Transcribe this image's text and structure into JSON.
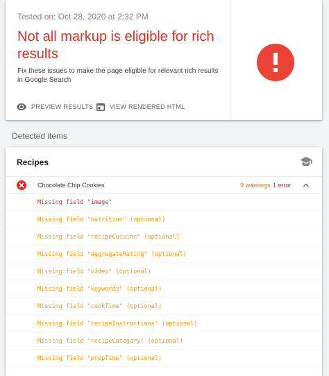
{
  "summary": {
    "tested_on": "Tested on: Oct 28, 2020 at 2:32 PM",
    "headline": "Not all markup is eligible for rich results",
    "subtext": "Fix these issues to make the page eligible for relevant rich results in Google Search",
    "preview_label": "PREVIEW RESULTS",
    "rendered_label": "VIEW RENDERED HTML",
    "status_color": "#ea4335"
  },
  "detected": {
    "label": "Detected items",
    "card_title": "Recipes",
    "item": {
      "name": "Chocolate Chip Cookies",
      "warnings": "9 warnings",
      "errors": "1 error"
    },
    "issues": [
      {
        "text": "Missing field \"image\"",
        "severity": "error"
      },
      {
        "text": "Missing field \"nutrition\" (optional)",
        "severity": "warning"
      },
      {
        "text": "Missing field \"recipeCuisine\" (optional)",
        "severity": "warning"
      },
      {
        "text": "Missing field \"aggregateRating\" (optional)",
        "severity": "warning"
      },
      {
        "text": "Missing field \"video\" (optional)",
        "severity": "warning"
      },
      {
        "text": "Missing field \"keywords\" (optional)",
        "severity": "warning"
      },
      {
        "text": "Missing field \"cookTime\" (optional)",
        "severity": "warning"
      },
      {
        "text": "Missing field \"recipeInstructions\" (optional)",
        "severity": "warning"
      },
      {
        "text": "Missing field \"recipeCategory\" (optional)",
        "severity": "warning"
      },
      {
        "text": "Missing field \"prepTime\" (optional)",
        "severity": "warning"
      }
    ]
  },
  "colors": {
    "error": "#d93025",
    "warning": "#f29900",
    "warning_count": "#e37400"
  },
  "icons": {
    "preview": "eye-icon",
    "rendered": "browser-window-icon",
    "status": "exclamation-icon",
    "learn": "graduation-cap-icon",
    "item_error": "error-x-icon",
    "collapse": "chevron-up-icon"
  }
}
